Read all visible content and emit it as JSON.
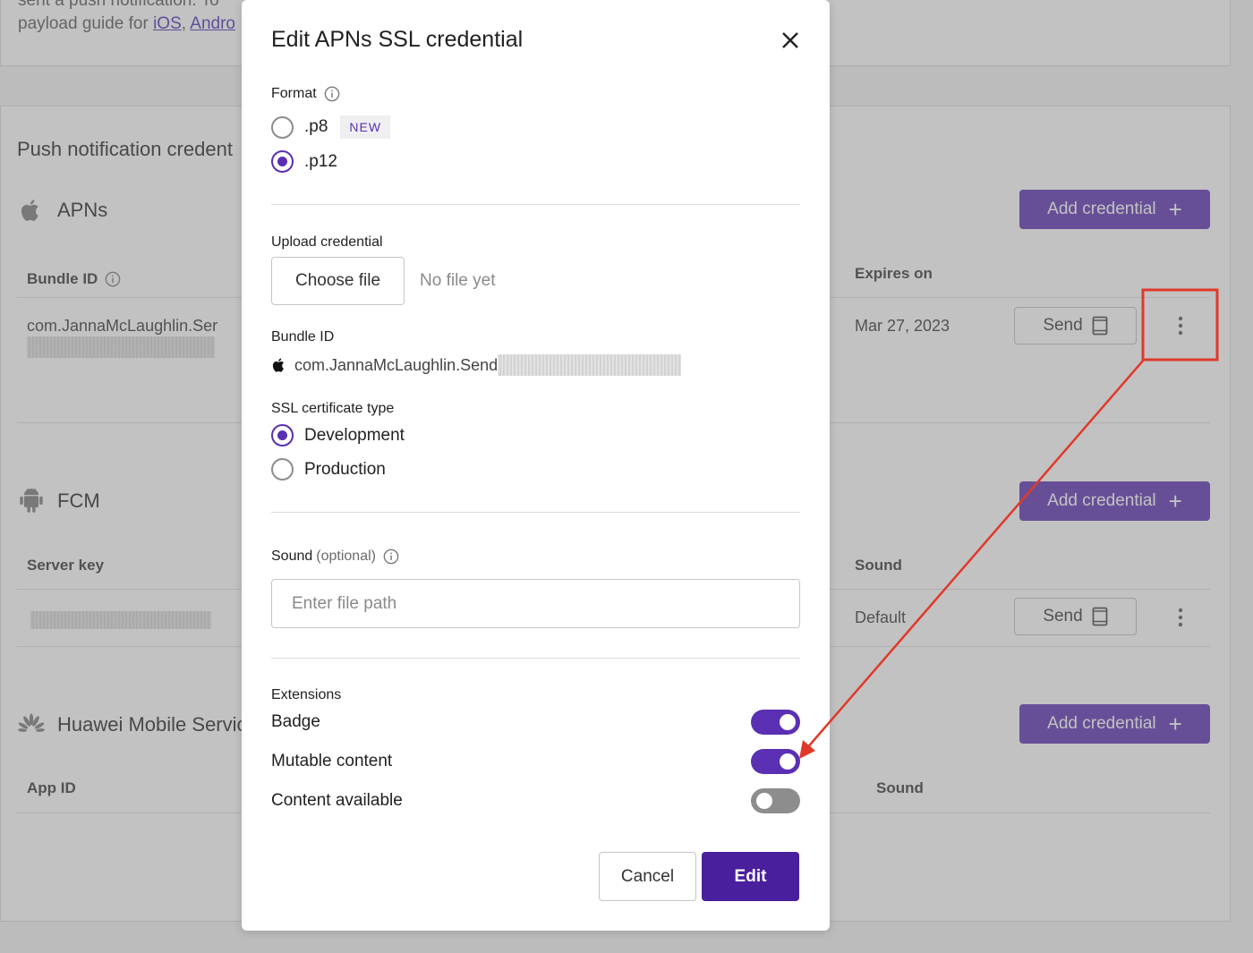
{
  "page": {
    "intro_line1": "sent a push notification. To",
    "intro_line2_prefix": "payload guide for ",
    "link_ios": "iOS",
    "link_android": "Andro",
    "section_title": "Push notification credent",
    "providers": {
      "apns": {
        "name": "APNs",
        "add_label": "Add credential",
        "col_bundle": "Bundle ID",
        "col_expires": "Expires on",
        "row_bundle": "com.JannaMcLaughlin.Ser",
        "row_expires": "Mar 27, 2023",
        "send_label": "Send"
      },
      "fcm": {
        "name": "FCM",
        "add_label": "Add credential",
        "col_key": "Server key",
        "col_sound": "Sound",
        "row_sound": "Default",
        "send_label": "Send"
      },
      "huawei": {
        "name": "Huawei Mobile Servic",
        "add_label": "Add credential",
        "col_app": "App ID",
        "col_sound": "Sound"
      }
    }
  },
  "modal": {
    "title": "Edit APNs SSL credential",
    "format_label": "Format",
    "format_options": [
      ".p8",
      ".p12"
    ],
    "format_selected": ".p12",
    "new_badge": "NEW",
    "upload_label": "Upload credential",
    "choose_file": "Choose file",
    "no_file": "No file yet",
    "bundle_label": "Bundle ID",
    "bundle_value": "com.JannaMcLaughlin.Send",
    "ssl_label": "SSL certificate type",
    "ssl_options": [
      "Development",
      "Production"
    ],
    "ssl_selected": "Development",
    "sound_label": "Sound",
    "sound_optional": "(optional)",
    "sound_placeholder": "Enter file path",
    "extensions_label": "Extensions",
    "extensions": [
      {
        "label": "Badge",
        "on": true
      },
      {
        "label": "Mutable content",
        "on": true
      },
      {
        "label": "Content available",
        "on": false
      }
    ],
    "cancel": "Cancel",
    "edit": "Edit"
  },
  "colors": {
    "accent": "#5a2fb3",
    "annotation": "#e0392b"
  }
}
